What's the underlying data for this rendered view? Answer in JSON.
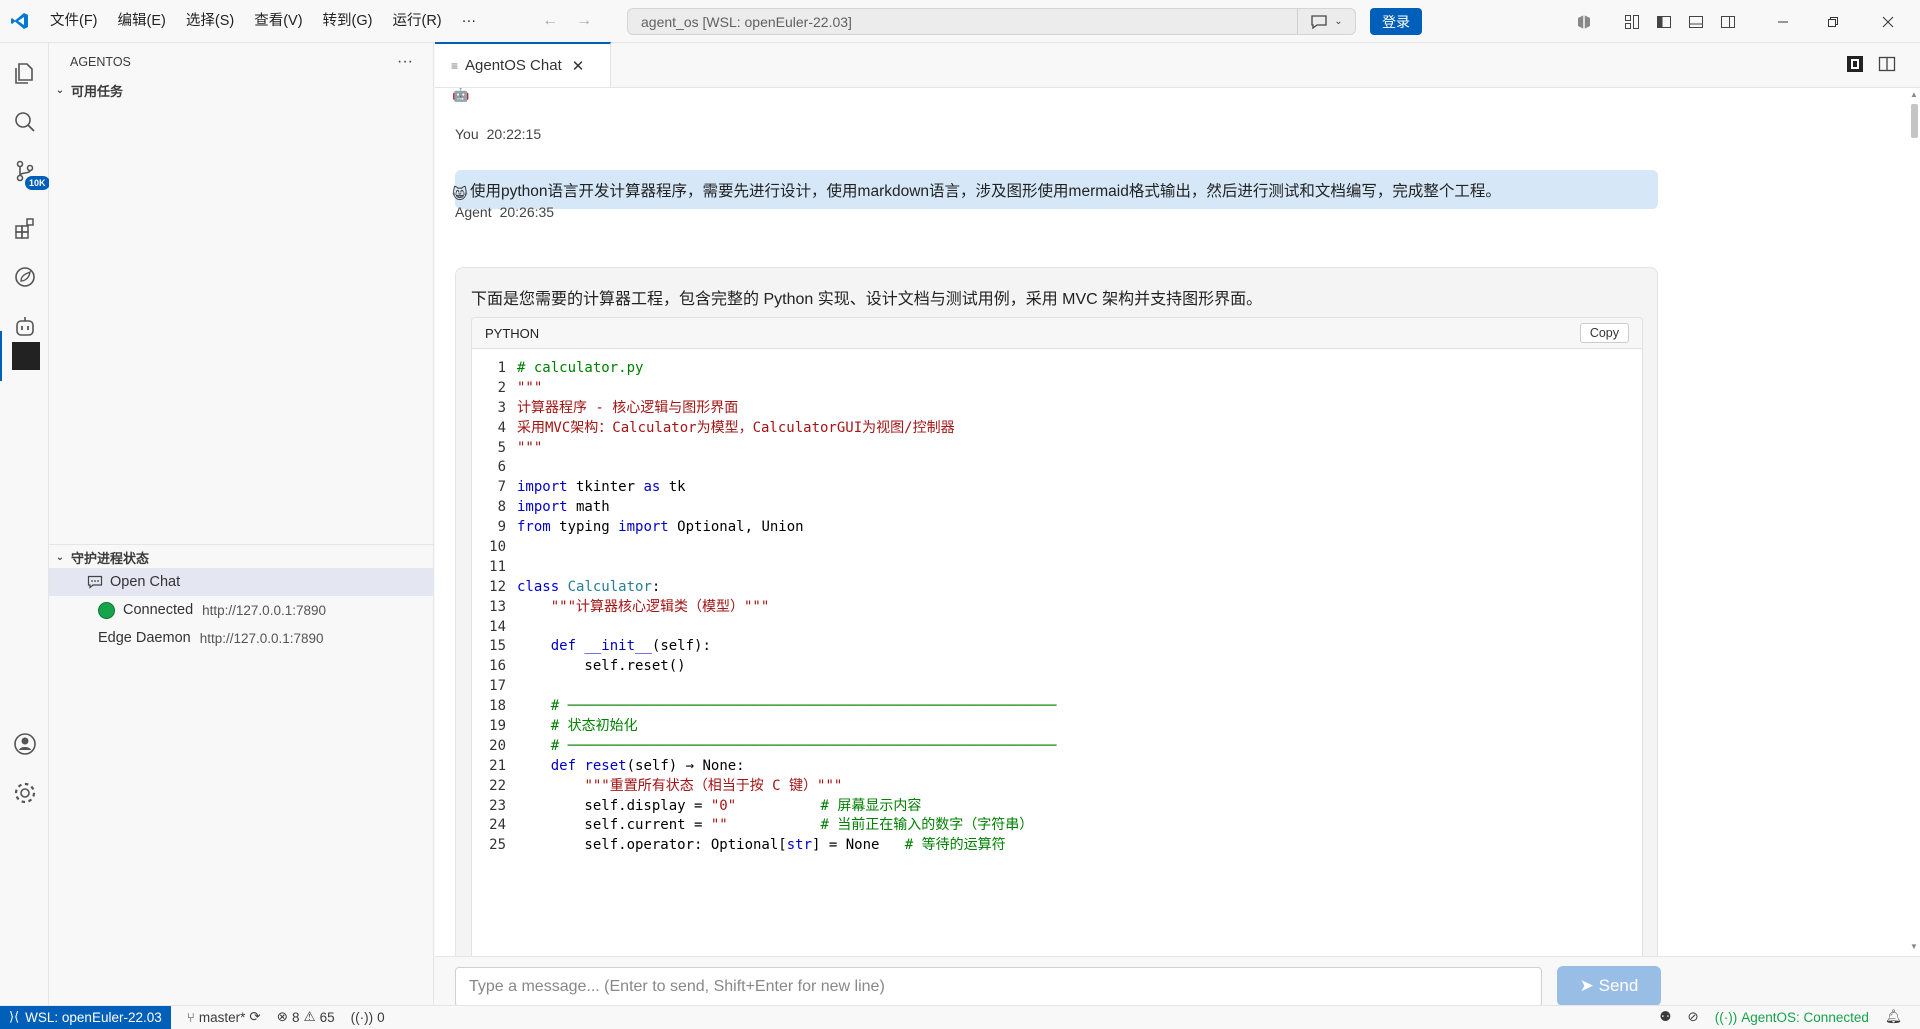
{
  "menu": [
    "文件(F)",
    "编辑(E)",
    "选择(S)",
    "查看(V)",
    "转到(G)",
    "运行(R)",
    "···"
  ],
  "command_center": "agent_os [WSL: openEuler-22.03]",
  "login_label": "登录",
  "activity": {
    "scm_badge": "10K"
  },
  "sidebar": {
    "title": "AGENTOS",
    "tasks_section": "可用任务",
    "daemon_section": "守护进程状态",
    "open_chat": "Open Chat",
    "connected_label": "Connected",
    "connected_url": "http://127.0.0.1:7890",
    "edge_label": "Edge Daemon",
    "edge_url": "http://127.0.0.1:7890"
  },
  "tab": {
    "label": "AgentOS Chat"
  },
  "chat": {
    "user_name": "You",
    "user_time": "20:22:15",
    "user_message": "使用python语言开发计算器程序，需要先进行设计，使用markdown语言，涉及图形使用mermaid格式输出，然后进行测试和文档编写，完成整个工程。",
    "agent_name": "Agent",
    "agent_time": "20:26:35",
    "agent_intro": "下面是您需要的计算器工程，包含完整的 Python 实现、设计文档与测试用例，采用 MVC 架构并支持图形界面。",
    "code_lang": "PYTHON",
    "copy_label": "Copy"
  },
  "code_lines": [
    [
      {
        "t": "# calculator.py",
        "c": "c"
      }
    ],
    [
      {
        "t": "\"\"\"",
        "c": "s"
      }
    ],
    [
      {
        "t": "计算器程序 - 核心逻辑与图形界面",
        "c": "s"
      }
    ],
    [
      {
        "t": "采用MVC架构：Calculator为模型，CalculatorGUI为视图/控制器",
        "c": "s"
      }
    ],
    [
      {
        "t": "\"\"\"",
        "c": "s"
      }
    ],
    [],
    [
      {
        "t": "import",
        "c": "k"
      },
      {
        "t": " tkinter ",
        "c": "p"
      },
      {
        "t": "as",
        "c": "k"
      },
      {
        "t": " tk",
        "c": "p"
      }
    ],
    [
      {
        "t": "import",
        "c": "k"
      },
      {
        "t": " math",
        "c": "p"
      }
    ],
    [
      {
        "t": "from",
        "c": "k"
      },
      {
        "t": " typing ",
        "c": "p"
      },
      {
        "t": "import",
        "c": "k"
      },
      {
        "t": " Optional, Union",
        "c": "p"
      }
    ],
    [],
    [],
    [
      {
        "t": "class",
        "c": "k"
      },
      {
        "t": " ",
        "c": "p"
      },
      {
        "t": "Calculator",
        "c": "cls"
      },
      {
        "t": ":",
        "c": "p"
      }
    ],
    [
      {
        "t": "    ",
        "c": "p"
      },
      {
        "t": "\"\"\"计算器核心逻辑类（模型）\"\"\"",
        "c": "s"
      }
    ],
    [],
    [
      {
        "t": "    ",
        "c": "p"
      },
      {
        "t": "def",
        "c": "k"
      },
      {
        "t": " ",
        "c": "p"
      },
      {
        "t": "__init__",
        "c": "f"
      },
      {
        "t": "(self):",
        "c": "p"
      }
    ],
    [
      {
        "t": "        self.reset()",
        "c": "p"
      }
    ],
    [],
    [
      {
        "t": "    # ──────────────────────────────────────────────────────────",
        "c": "c"
      }
    ],
    [
      {
        "t": "    # 状态初始化",
        "c": "c"
      }
    ],
    [
      {
        "t": "    # ──────────────────────────────────────────────────────────",
        "c": "c"
      }
    ],
    [
      {
        "t": "    ",
        "c": "p"
      },
      {
        "t": "def",
        "c": "k"
      },
      {
        "t": " ",
        "c": "p"
      },
      {
        "t": "reset",
        "c": "f"
      },
      {
        "t": "(self) → None:",
        "c": "p"
      }
    ],
    [
      {
        "t": "        ",
        "c": "p"
      },
      {
        "t": "\"\"\"重置所有状态（相当于按 C 键）\"\"\"",
        "c": "s"
      }
    ],
    [
      {
        "t": "        self.display = ",
        "c": "p"
      },
      {
        "t": "\"0\"",
        "c": "s"
      },
      {
        "t": "          ",
        "c": "p"
      },
      {
        "t": "# 屏幕显示内容",
        "c": "c"
      }
    ],
    [
      {
        "t": "        self.current = ",
        "c": "p"
      },
      {
        "t": "\"\"",
        "c": "s"
      },
      {
        "t": "           ",
        "c": "p"
      },
      {
        "t": "# 当前正在输入的数字（字符串）",
        "c": "c"
      }
    ],
    [
      {
        "t": "        self.operator: Optional[",
        "c": "p"
      },
      {
        "t": "str",
        "c": "k"
      },
      {
        "t": "] = None   ",
        "c": "p"
      },
      {
        "t": "# 等待的运算符",
        "c": "c"
      }
    ]
  ],
  "input": {
    "placeholder": "Type a message... (Enter to send, Shift+Enter for new line)",
    "send_label": "➤ Send"
  },
  "status": {
    "remote": "WSL: openEuler-22.03",
    "branch": "master*",
    "errors": "8",
    "warnings": "65",
    "ports": "0",
    "agentos": "AgentOS: Connected"
  },
  "colors": {
    "accent": "#005fb8",
    "user_bubble": "#d6e8f8",
    "connected": "#16a34a"
  }
}
